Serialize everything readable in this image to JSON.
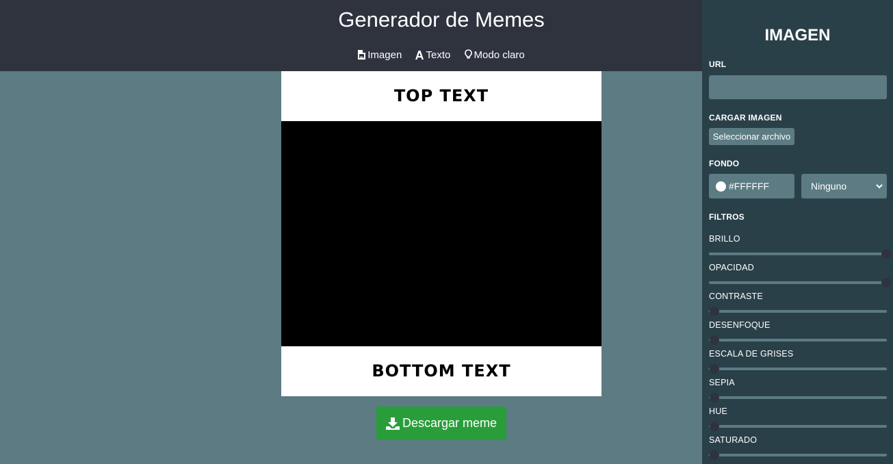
{
  "header": {
    "title": "Generador de Memes",
    "nav": [
      {
        "label": "Imagen",
        "icon": "file-image-icon"
      },
      {
        "label": "Texto",
        "icon": "font-icon"
      },
      {
        "label": "Modo claro",
        "icon": "lightbulb-icon"
      }
    ]
  },
  "meme": {
    "top_text": "TOP TEXT",
    "bottom_text": "BOTTOM TEXT",
    "image_background": "#000000"
  },
  "download": {
    "label": "Descargar meme",
    "icon": "download-icon",
    "color": "#2a9d3b"
  },
  "panel": {
    "title": "IMAGEN",
    "url_label": "URL",
    "url_value": "",
    "upload_label": "CARGAR IMAGEN",
    "upload_button": "Seleccionar archivo",
    "background_label": "FONDO",
    "background_color": "#FFFFFF",
    "blend_mode": "Ninguno",
    "filters_label": "FILTROS",
    "filters": [
      {
        "label": "BRILLO",
        "value": 1.0
      },
      {
        "label": "OPACIDAD",
        "value": 1.0
      },
      {
        "label": "CONTRASTE",
        "value": 0.0
      },
      {
        "label": "DESENFOQUE",
        "value": 0.0
      },
      {
        "label": "ESCALA DE GRISES",
        "value": 0.0
      },
      {
        "label": "SEPIA",
        "value": 0.0
      },
      {
        "label": "HUE",
        "value": 0.0
      },
      {
        "label": "SATURADO",
        "value": 0.0
      }
    ]
  },
  "colors": {
    "header_bg": "#2e333e",
    "page_bg": "#5c7b83",
    "panel_bg": "#2a4049"
  }
}
